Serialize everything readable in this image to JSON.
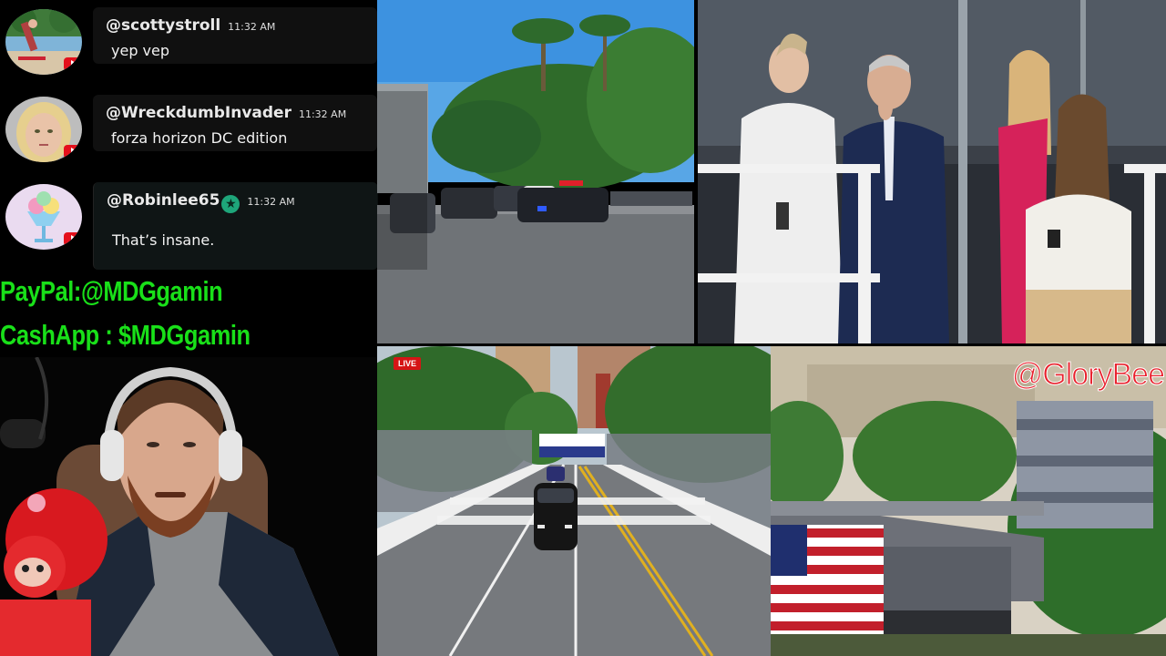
{
  "chat": [
    {
      "username": "@scottystroll",
      "time": "11:32 AM",
      "message": "yep vep",
      "avatar_icon": "skater-avatar",
      "badge": "youtube-icon"
    },
    {
      "username": "@WreckdumbInvader",
      "time": "11:32 AM",
      "message": "forza horizon DC edition",
      "avatar_icon": "blonde-woman-avatar",
      "badge": "youtube-icon"
    },
    {
      "username": "@Robinlee65",
      "time": "11:32 AM",
      "message": "That’s insane.",
      "avatar_icon": "ice-cream-avatar",
      "badge": "youtube-icon",
      "member_badge": "★"
    }
  ],
  "donation": {
    "paypal": "PayPal:@MDGgamin",
    "cashapp": "CashApp : $MDGgamin",
    "color": "#19e019"
  },
  "panels": {
    "motorcade": {
      "live_label": "LIVE"
    },
    "grandstand": {
      "watermark": "@GloryBee"
    }
  },
  "colors": {
    "youtube_red": "#e4101c",
    "live_red": "#d51515",
    "watermark_red": "#e8202c"
  }
}
